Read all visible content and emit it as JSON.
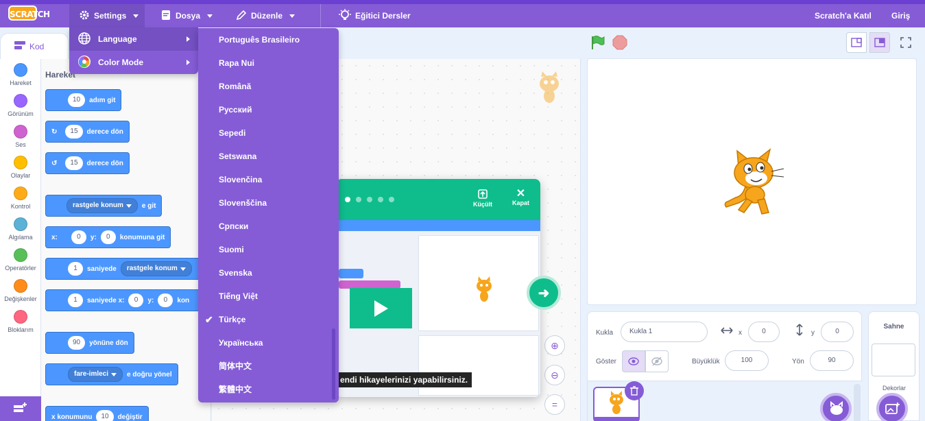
{
  "menubar": {
    "logo": "SCRATCH",
    "settings": "Settings",
    "file": "Dosya",
    "edit": "Düzenle",
    "tutorials": "Eğitici Dersler",
    "join": "Scratch'a Katıl",
    "signin": "Giriş"
  },
  "settings_menu": {
    "language": "Language",
    "color_mode": "Color Mode"
  },
  "language_menu": {
    "items": [
      "Português Brasileiro",
      "Rapa Nui",
      "Română",
      "Русский",
      "Sepedi",
      "Setswana",
      "Slovenčina",
      "Slovenščina",
      "Српски",
      "Suomi",
      "Svenska",
      "Tiếng Việt",
      "Türkçe",
      "Українська",
      "简体中文",
      "繁體中文"
    ],
    "selected": "Türkçe"
  },
  "tabs": {
    "code": "Kod"
  },
  "categories": [
    {
      "label": "Hareket",
      "color": "#4c97ff"
    },
    {
      "label": "Görünüm",
      "color": "#9966ff"
    },
    {
      "label": "Ses",
      "color": "#cf63cf"
    },
    {
      "label": "Olaylar",
      "color": "#ffbf00"
    },
    {
      "label": "Kontrol",
      "color": "#ffab19"
    },
    {
      "label": "Algılama",
      "color": "#5cb1d6"
    },
    {
      "label": "Operatörler",
      "color": "#59c059"
    },
    {
      "label": "Değişkenler",
      "color": "#ff8c1a"
    },
    {
      "label": "Bloklarım",
      "color": "#ff6680"
    }
  ],
  "palette": {
    "title": "Hareket",
    "move_steps": "10",
    "move_label": "adım git",
    "turn_right_value": "15",
    "turn_right_label": "derece dön",
    "turn_left_value": "15",
    "turn_left_label": "derece dön",
    "goto_dropdown": "rastgele konum",
    "goto_label": "e git",
    "gotoxy_x_label": "x:",
    "gotoxy_x": "0",
    "gotoxy_y_label": "y:",
    "gotoxy_y": "0",
    "gotoxy_label": "konumuna git",
    "glide_secs": "1",
    "glide_label": "saniyede",
    "glide_dropdown": "rastgele konum",
    "glidexy_secs": "1",
    "glidexy_label": "saniyede x:",
    "glidexy_x": "0",
    "glidexy_y_label": "y:",
    "glidexy_y": "0",
    "glidexy_tail": "kon",
    "point_dir": "90",
    "point_label": "yönüne dön",
    "point_towards_dropdown": "fare-imleci",
    "point_towards_label": "e doğru yönel",
    "set_x_label": "x konumunu",
    "set_x_value": "10",
    "set_x_tail": "değiştir"
  },
  "tutorial": {
    "shrink": "Küçült",
    "close": "Kapat",
    "caption": "endi hikayelerinizi yapabilirsiniz.",
    "progress_dots": 5,
    "active_dot": 0
  },
  "sprite_info": {
    "sprite_label": "Kukla",
    "sprite_name": "Kukla 1",
    "x_label": "x",
    "x_value": "0",
    "y_label": "y",
    "y_value": "0",
    "show_label": "Göster",
    "size_label": "Büyüklük",
    "size_value": "100",
    "direction_label": "Yön",
    "direction_value": "90"
  },
  "stage_pane": {
    "title": "Sahne",
    "backdrops_label": "Dekorlar"
  },
  "colors": {
    "accent": "#855cd6",
    "motion": "#4c97ff",
    "tutorial_green": "#0fbd8c",
    "stop_red": "#ec9c9c",
    "flag_green": "#4cbf56"
  }
}
